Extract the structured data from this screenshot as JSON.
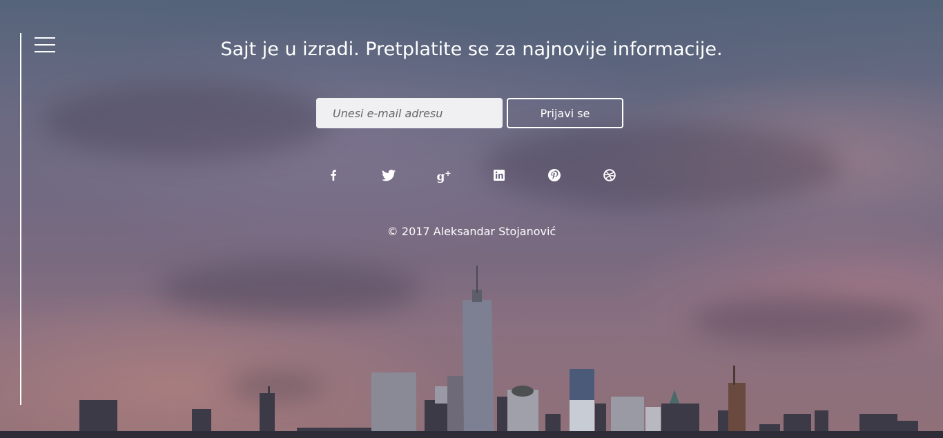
{
  "headline": "Sajt je u izradi. Pretplatite se za najnovije informacije.",
  "subscribe": {
    "email_placeholder": "Unesi e-mail adresu",
    "email_value": "",
    "submit_label": "Prijavi se"
  },
  "social": [
    {
      "name": "facebook",
      "icon": "facebook-icon"
    },
    {
      "name": "twitter",
      "icon": "twitter-icon"
    },
    {
      "name": "google-plus",
      "icon": "google-plus-icon"
    },
    {
      "name": "linkedin",
      "icon": "linkedin-icon"
    },
    {
      "name": "pinterest",
      "icon": "pinterest-icon"
    },
    {
      "name": "dribbble",
      "icon": "dribbble-icon"
    }
  ],
  "footer": {
    "copyright": "© 2017 Aleksandar Stojanović"
  },
  "colors": {
    "text": "#ffffff",
    "input_background": "#f0f0f2",
    "sky_top": "#55647a",
    "sky_bottom": "#907078"
  }
}
